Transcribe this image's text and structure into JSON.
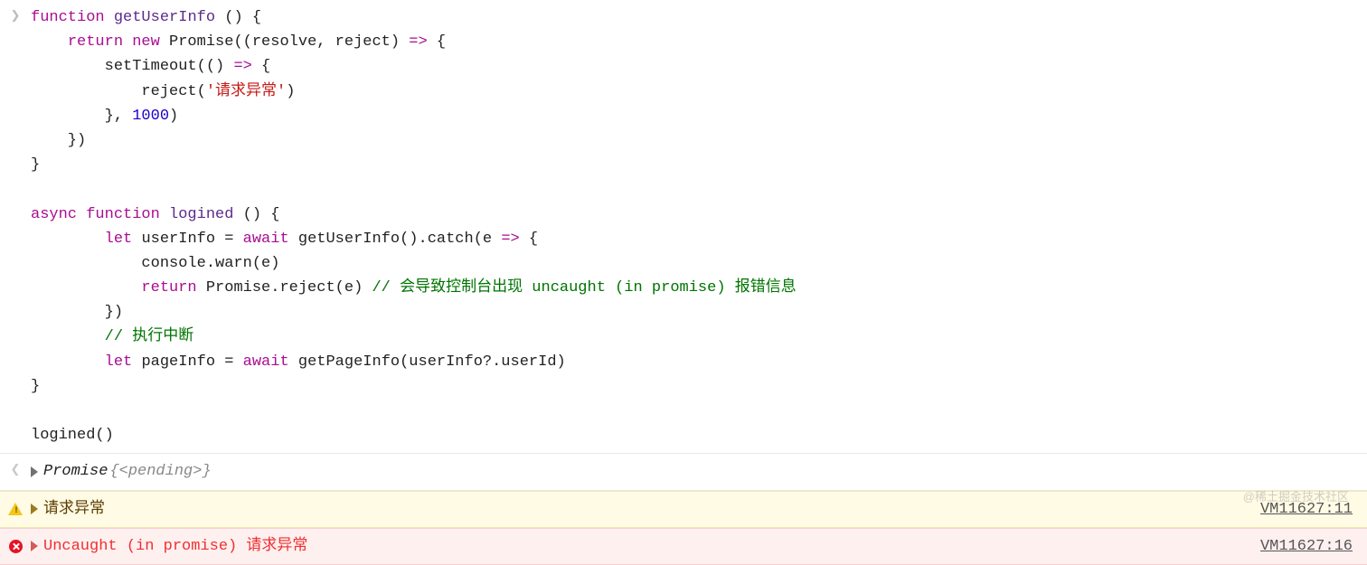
{
  "input": {
    "tokens": [
      {
        "t": "function ",
        "c": "kw"
      },
      {
        "t": "getUserInfo ",
        "c": "fn"
      },
      {
        "t": "() {\n"
      },
      {
        "t": "    "
      },
      {
        "t": "return new ",
        "c": "kw"
      },
      {
        "t": "Promise",
        "c": ""
      },
      {
        "t": "((resolve, reject) "
      },
      {
        "t": "=>",
        "c": "kw"
      },
      {
        "t": " {\n"
      },
      {
        "t": "        setTimeout(() "
      },
      {
        "t": "=>",
        "c": "kw"
      },
      {
        "t": " {\n"
      },
      {
        "t": "            reject("
      },
      {
        "t": "'请求异常'",
        "c": "str"
      },
      {
        "t": ")\n"
      },
      {
        "t": "        }, "
      },
      {
        "t": "1000",
        "c": "num"
      },
      {
        "t": ")\n"
      },
      {
        "t": "    })\n"
      },
      {
        "t": "}\n"
      },
      {
        "t": "\n"
      },
      {
        "t": "async function ",
        "c": "kw"
      },
      {
        "t": "logined ",
        "c": "fn"
      },
      {
        "t": "() {\n"
      },
      {
        "t": "        "
      },
      {
        "t": "let ",
        "c": "kw"
      },
      {
        "t": "userInfo = "
      },
      {
        "t": "await ",
        "c": "kw"
      },
      {
        "t": "getUserInfo().catch(e "
      },
      {
        "t": "=>",
        "c": "kw"
      },
      {
        "t": " {\n"
      },
      {
        "t": "            console.warn(e)\n"
      },
      {
        "t": "            "
      },
      {
        "t": "return ",
        "c": "kw"
      },
      {
        "t": "Promise.reject(e) "
      },
      {
        "t": "// 会导致控制台出现 uncaught (in promise) 报错信息",
        "c": "comment"
      },
      {
        "t": "\n"
      },
      {
        "t": "        })\n"
      },
      {
        "t": "        "
      },
      {
        "t": "// 执行中断",
        "c": "comment"
      },
      {
        "t": "\n"
      },
      {
        "t": "        "
      },
      {
        "t": "let ",
        "c": "kw"
      },
      {
        "t": "pageInfo = "
      },
      {
        "t": "await ",
        "c": "kw"
      },
      {
        "t": "getPageInfo(userInfo?.userId)\n"
      },
      {
        "t": "}\n"
      },
      {
        "t": "\n"
      },
      {
        "t": "logined()"
      }
    ]
  },
  "output": {
    "object_label": "Promise ",
    "pending": "{<pending>}"
  },
  "warn": {
    "message": "请求异常",
    "source": "VM11627:11"
  },
  "error": {
    "message": "Uncaught (in promise) 请求异常",
    "source": "VM11627:16"
  },
  "watermark": "@稀土掘金技术社区"
}
